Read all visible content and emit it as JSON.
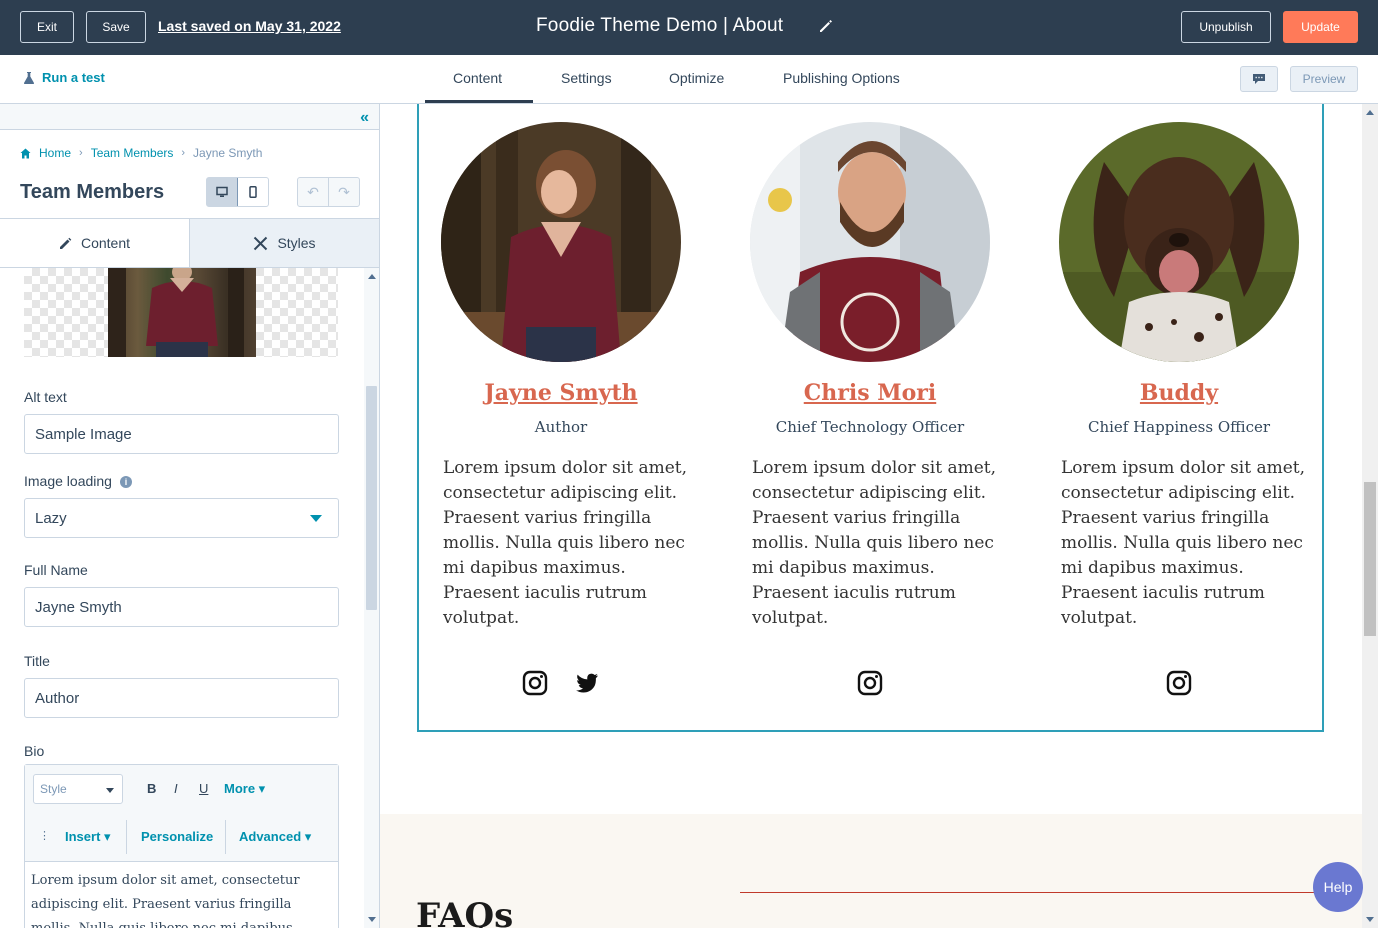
{
  "topbar": {
    "exit_label": "Exit",
    "save_label": "Save",
    "last_saved": "Last saved on May 31, 2022",
    "page_title": "Foodie Theme Demo | About",
    "unpublish_label": "Unpublish",
    "update_label": "Update",
    "accent_color": "#ff7a59"
  },
  "tabbar": {
    "run_test": "Run a test",
    "tabs": [
      {
        "label": "Content",
        "active": true
      },
      {
        "label": "Settings",
        "active": false
      },
      {
        "label": "Optimize",
        "active": false
      },
      {
        "label": "Publishing Options",
        "active": false
      }
    ],
    "preview_label": "Preview"
  },
  "sidebar": {
    "breadcrumbs": [
      "Home",
      "Team Members",
      "Jayne Smyth"
    ],
    "title": "Team Members",
    "subtabs": [
      "Content",
      "Styles"
    ],
    "fields": {
      "alt_text": {
        "label": "Alt text",
        "value": "Sample Image"
      },
      "image_loading": {
        "label": "Image loading",
        "value": "Lazy"
      },
      "full_name": {
        "label": "Full Name",
        "value": "Jayne Smyth"
      },
      "title": {
        "label": "Title",
        "value": "Author"
      },
      "bio": {
        "label": "Bio",
        "toolbar": {
          "style_placeholder": "Style",
          "bold": "B",
          "italic": "I",
          "underline": "U",
          "more": "More",
          "insert": "Insert",
          "personalize": "Personalize",
          "advanced": "Advanced"
        },
        "text": "Lorem ipsum dolor sit amet, consectetur adipiscing elit. Praesent varius fringilla mollis. Nulla quis libero nec mi dapibus maximus."
      }
    }
  },
  "canvas": {
    "members": [
      {
        "name": "Jayne Smyth",
        "title": "Author",
        "bio": "Lorem ipsum dolor sit amet, consectetur adipiscing elit. Praesent varius fringilla mollis. Nulla quis libero nec mi dapibus maximus. Praesent iaculis rutrum volutpat.",
        "socials": [
          "instagram-icon",
          "twitter-icon"
        ]
      },
      {
        "name": "Chris Mori",
        "title": "Chief Technology Officer",
        "bio": "Lorem ipsum dolor sit amet, consectetur adipiscing elit. Praesent varius fringilla mollis. Nulla quis libero nec mi dapibus maximus. Praesent iaculis rutrum volutpat.",
        "socials": [
          "instagram-icon"
        ]
      },
      {
        "name": "Buddy",
        "title": "Chief Happiness Officer",
        "bio": "Lorem ipsum dolor sit amet, consectetur adipiscing elit. Praesent varius fringilla mollis. Nulla quis libero nec mi dapibus maximus. Praesent iaculis rutrum volutpat.",
        "socials": [
          "instagram-icon"
        ]
      }
    ],
    "name_color": "#d8674f",
    "faq_heading": "FAQs"
  },
  "help_label": "Help"
}
